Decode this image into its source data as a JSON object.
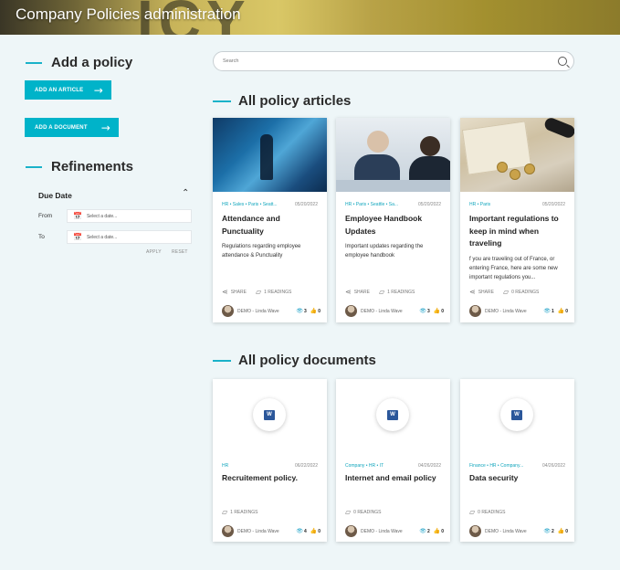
{
  "header": {
    "title": "Company Policies administration",
    "banner_decoration": "ICY"
  },
  "sidebar": {
    "add_policy_heading": "Add a policy",
    "add_article_label": "ADD AN ARTICLE",
    "add_document_label": "ADD A DOCUMENT",
    "refinements_heading": "Refinements",
    "due_date": {
      "title": "Due Date",
      "from_label": "From",
      "to_label": "To",
      "from_placeholder": "Select a date...",
      "to_placeholder": "Select a date...",
      "apply_label": "APPLY",
      "reset_label": "RESET"
    }
  },
  "search": {
    "placeholder": "Search"
  },
  "articles_section": {
    "heading": "All policy articles",
    "share_label": "SHARE",
    "items": [
      {
        "tags": "HR • Sales • Paris • Seatt...",
        "date": "05/20/2022",
        "title": "Attendance and Punctuality",
        "description": "Regulations regarding employee attendance & Punctuality",
        "readings": "1 READINGS",
        "author": "DEMO - Linda Wave",
        "views": "3",
        "likes": "0"
      },
      {
        "tags": "HR • Paris • Seattle • Sa...",
        "date": "05/20/2022",
        "title": "Employee Handbook Updates",
        "description": "Important updates regarding the employee handbook",
        "readings": "1 READINGS",
        "author": "DEMO - Linda Wave",
        "views": "3",
        "likes": "0"
      },
      {
        "tags": "HR • Paris",
        "date": "05/20/2022",
        "title": "Important regulations to keep in mind when traveling",
        "description": "f you are traveling out of France, or entering France, here are some new important regulations you...",
        "readings": "0 READINGS",
        "author": "DEMO - Linda Wave",
        "views": "1",
        "likes": "0"
      }
    ]
  },
  "documents_section": {
    "heading": "All policy documents",
    "items": [
      {
        "tags": "HR",
        "date": "06/22/2022",
        "title": "Recruitement policy.",
        "readings": "1 READINGS",
        "author": "DEMO - Linda Wave",
        "views": "4",
        "likes": "0",
        "icon": "word-icon"
      },
      {
        "tags": "Company • HR • IT",
        "date": "04/26/2022",
        "title": "Internet and email policy",
        "readings": "0 READINGS",
        "author": "DEMO - Linda Wave",
        "views": "2",
        "likes": "0",
        "icon": "word-icon"
      },
      {
        "tags": "Finance • HR • Company...",
        "date": "04/26/2022",
        "title": "Data security",
        "readings": "0 READINGS",
        "author": "DEMO - Linda Wave",
        "views": "2",
        "likes": "0",
        "icon": "word-icon"
      }
    ]
  },
  "colors": {
    "accent": "#00b3c9",
    "tag": "#12a6bd",
    "background": "#eef6f8",
    "word": "#2b579a"
  }
}
